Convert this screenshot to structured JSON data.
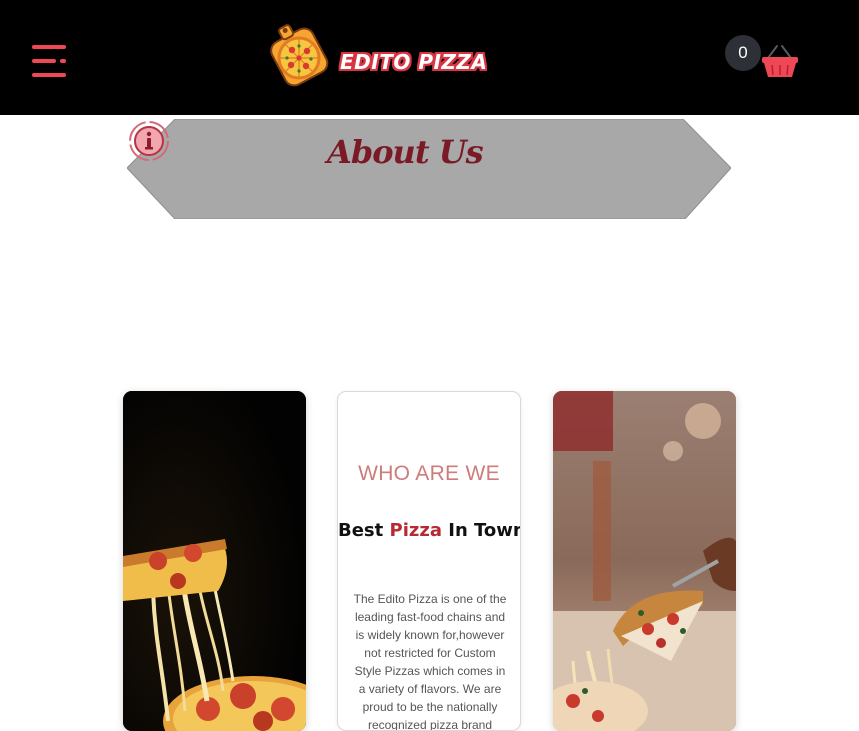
{
  "header": {
    "brand": "EDITO PIZZA",
    "menu_icon": "hamburger-menu-icon",
    "cart_count": "0",
    "cart_icon": "shopping-basket-icon"
  },
  "banner": {
    "title": "About Us",
    "icon": "info-icon"
  },
  "cards": {
    "left_image": "cheese-pull-pizza-slice-photo",
    "who_heading": "WHO ARE WE",
    "tagline_prefix": "Best ",
    "tagline_highlight": "Pizza",
    "tagline_suffix": " In Town",
    "description": "The Edito Pizza is one of the leading fast-food chains and is widely known for,however not restricted for Custom Style Pizzas which comes in a variety of flavors. We are proud to be the nationally recognized pizza brand",
    "right_image": "pizza-slice-on-server-photo"
  },
  "colors": {
    "accent": "#ef4756",
    "dark_red": "#7a1a26",
    "banner_gray": "#a8a8a8",
    "who_pink": "#cf7b7b"
  }
}
